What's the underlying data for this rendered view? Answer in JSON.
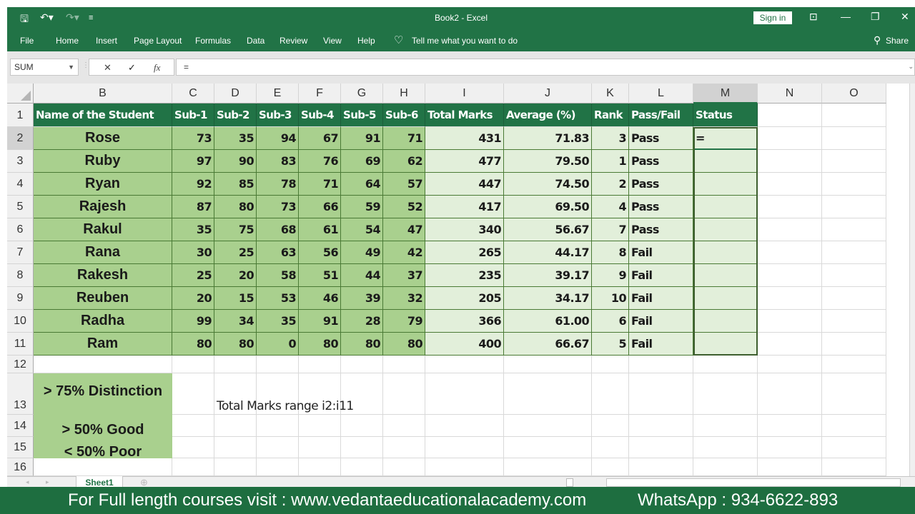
{
  "window": {
    "title": "Book2  -  Excel",
    "sign_in": "Sign in",
    "qa_save_icon": "save-icon",
    "qa_undo_icon": "undo-icon",
    "qa_redo_icon": "redo-icon"
  },
  "ribbon": {
    "tabs": [
      "File",
      "Home",
      "Insert",
      "Page Layout",
      "Formulas",
      "Data",
      "Review",
      "View",
      "Help"
    ],
    "tell_me": "Tell me what you want to do",
    "share": "Share"
  },
  "formula_bar": {
    "name_box": "SUM",
    "cancel": "✕",
    "enter": "✓",
    "fx": "fx",
    "content": "="
  },
  "columns": [
    "B",
    "C",
    "D",
    "E",
    "F",
    "G",
    "H",
    "I",
    "J",
    "K",
    "L",
    "M",
    "N",
    "O"
  ],
  "rows": [
    "1",
    "2",
    "3",
    "4",
    "5",
    "6",
    "7",
    "8",
    "9",
    "10",
    "11",
    "12",
    "13",
    "14",
    "15",
    "16"
  ],
  "headers": [
    "Name of the Student",
    "Sub-1",
    "Sub-2",
    "Sub-3",
    "Sub-4",
    "Sub-5",
    "Sub-6",
    "Total Marks",
    "Average (%)",
    "Rank",
    "Pass/Fail",
    "Status"
  ],
  "students": [
    {
      "name": "Rose",
      "marks": [
        "73",
        "35",
        "94",
        "67",
        "91",
        "71"
      ],
      "total": "431",
      "avg": "71.83",
      "rank": "3",
      "result": "Pass",
      "status": "="
    },
    {
      "name": "Ruby",
      "marks": [
        "97",
        "90",
        "83",
        "76",
        "69",
        "62"
      ],
      "total": "477",
      "avg": "79.50",
      "rank": "1",
      "result": "Pass",
      "status": ""
    },
    {
      "name": "Ryan",
      "marks": [
        "92",
        "85",
        "78",
        "71",
        "64",
        "57"
      ],
      "total": "447",
      "avg": "74.50",
      "rank": "2",
      "result": "Pass",
      "status": ""
    },
    {
      "name": "Rajesh",
      "marks": [
        "87",
        "80",
        "73",
        "66",
        "59",
        "52"
      ],
      "total": "417",
      "avg": "69.50",
      "rank": "4",
      "result": "Pass",
      "status": ""
    },
    {
      "name": "Rakul",
      "marks": [
        "35",
        "75",
        "68",
        "61",
        "54",
        "47"
      ],
      "total": "340",
      "avg": "56.67",
      "rank": "7",
      "result": "Pass",
      "status": ""
    },
    {
      "name": "Rana",
      "marks": [
        "30",
        "25",
        "63",
        "56",
        "49",
        "42"
      ],
      "total": "265",
      "avg": "44.17",
      "rank": "8",
      "result": "Fail",
      "status": ""
    },
    {
      "name": "Rakesh",
      "marks": [
        "25",
        "20",
        "58",
        "51",
        "44",
        "37"
      ],
      "total": "235",
      "avg": "39.17",
      "rank": "9",
      "result": "Fail",
      "status": ""
    },
    {
      "name": "Reuben",
      "marks": [
        "20",
        "15",
        "53",
        "46",
        "39",
        "32"
      ],
      "total": "205",
      "avg": "34.17",
      "rank": "10",
      "result": "Fail",
      "status": ""
    },
    {
      "name": "Radha",
      "marks": [
        "99",
        "34",
        "35",
        "91",
        "28",
        "79"
      ],
      "total": "366",
      "avg": "61.00",
      "rank": "6",
      "result": "Fail",
      "status": ""
    },
    {
      "name": "Ram",
      "marks": [
        "80",
        "80",
        "0",
        "80",
        "80",
        "80"
      ],
      "total": "400",
      "avg": "66.67",
      "rank": "5",
      "result": "Fail",
      "status": ""
    }
  ],
  "legend": [
    "> 75% Distinction",
    "> 50% Good",
    "< 50% Poor"
  ],
  "note": "Total Marks range i2:i11",
  "sheet_tab": "Sheet1",
  "footer": {
    "left": "For Full length courses visit : www.vedantaeducationalacademy.com",
    "right": "WhatsApp : 934-6622-893"
  },
  "colors": {
    "accent": "#217346",
    "name_fill": "#a9d08e",
    "light_fill": "#e2efda"
  }
}
